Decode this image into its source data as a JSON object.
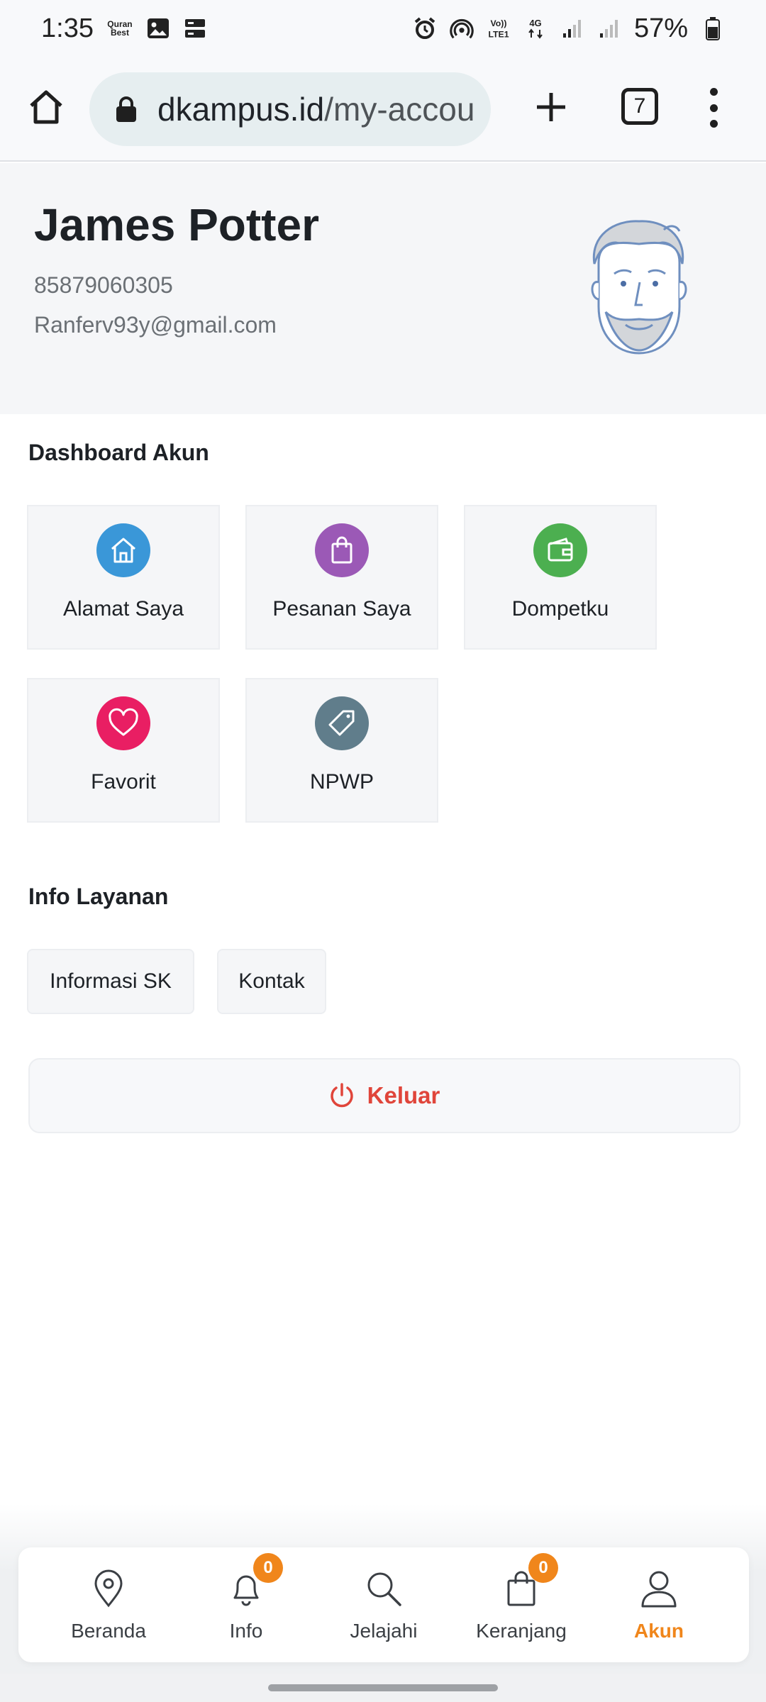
{
  "status_bar": {
    "time": "1:35",
    "app_badge": "Quran Best",
    "battery": "57%"
  },
  "browser": {
    "url_host": "dkampus.id",
    "url_path": "/my-accou",
    "tab_count": "7"
  },
  "profile": {
    "name": "James Potter",
    "phone": "85879060305",
    "email": "Ranferv93y@gmail.com"
  },
  "dashboard": {
    "title": "Dashboard Akun",
    "items": [
      {
        "label": "Alamat Saya",
        "icon": "home-icon",
        "color": "#3a97d8"
      },
      {
        "label": "Pesanan Saya",
        "icon": "shopping-bag-icon",
        "color": "#9b59b6"
      },
      {
        "label": "Dompetku",
        "icon": "wallet-icon",
        "color": "#4caf50"
      },
      {
        "label": "Favorit",
        "icon": "heart-icon",
        "color": "#e91e63"
      },
      {
        "label": "NPWP",
        "icon": "tag-icon",
        "color": "#607d8b"
      }
    ]
  },
  "info": {
    "title": "Info Layanan",
    "links": [
      {
        "label": "Informasi SK"
      },
      {
        "label": "Kontak"
      }
    ]
  },
  "logout": {
    "label": "Keluar",
    "color": "#e0453a"
  },
  "bottom_nav": {
    "accent": "#f0861b",
    "items": [
      {
        "label": "Beranda",
        "icon": "map-pin-icon"
      },
      {
        "label": "Info",
        "icon": "bell-icon",
        "badge": "0"
      },
      {
        "label": "Jelajahi",
        "icon": "search-icon"
      },
      {
        "label": "Keranjang",
        "icon": "cart-icon",
        "badge": "0"
      },
      {
        "label": "Akun",
        "icon": "user-icon",
        "active": true
      }
    ]
  }
}
